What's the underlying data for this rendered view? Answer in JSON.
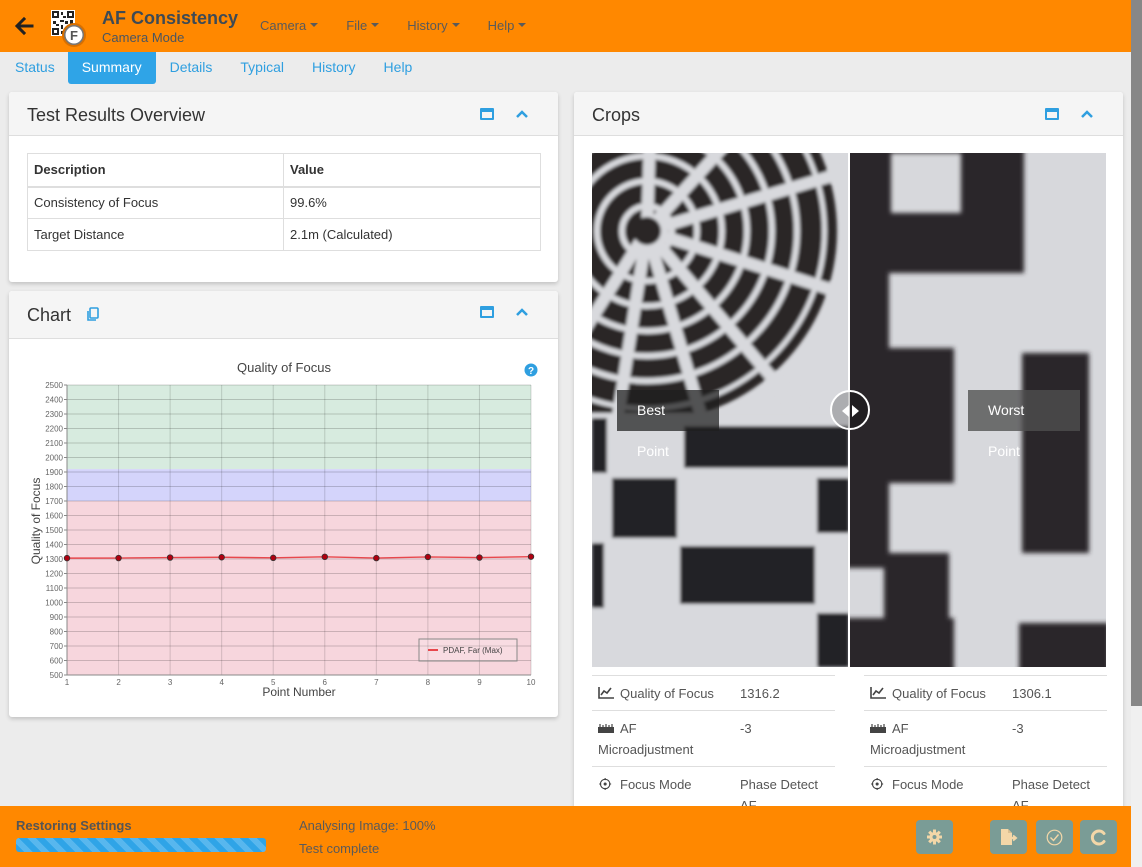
{
  "header": {
    "title": "AF Consistency",
    "subtitle": "Camera Mode",
    "menus": [
      {
        "label": "Camera"
      },
      {
        "label": "File"
      },
      {
        "label": "History"
      },
      {
        "label": "Help"
      }
    ]
  },
  "tabs": [
    {
      "label": "Status",
      "active": false
    },
    {
      "label": "Summary",
      "active": true
    },
    {
      "label": "Details",
      "active": false
    },
    {
      "label": "Typical",
      "active": false
    },
    {
      "label": "History",
      "active": false
    },
    {
      "label": "Help",
      "active": false
    }
  ],
  "overview": {
    "title": "Test Results Overview",
    "columns": [
      "Description",
      "Value"
    ],
    "rows": [
      {
        "description": "Consistency of Focus",
        "value": "99.6%"
      },
      {
        "description": "Target Distance",
        "value": "2.1m (Calculated)"
      }
    ]
  },
  "chart_panel": {
    "title": "Chart"
  },
  "chart_data": {
    "type": "line",
    "title": "Quality of Focus",
    "xlabel": "Point Number",
    "ylabel": "Quality of Focus",
    "x": [
      1,
      2,
      3,
      4,
      5,
      6,
      7,
      8,
      9,
      10
    ],
    "xlim": [
      1,
      10
    ],
    "ylim": [
      500,
      2500
    ],
    "yticks": [
      500,
      600,
      700,
      800,
      900,
      1000,
      1100,
      1200,
      1300,
      1400,
      1500,
      1600,
      1700,
      1800,
      1900,
      2000,
      2100,
      2200,
      2300,
      2400,
      2500
    ],
    "series": [
      {
        "name": "PDAF, Far (Max)",
        "values": [
          1306.1,
          1306.5,
          1310,
          1312,
          1308,
          1315,
          1306.3,
          1314,
          1310,
          1316.2
        ],
        "color": "#e8474c"
      }
    ],
    "bands": [
      {
        "from": 1920,
        "to": 2500,
        "color": "#d7ebdf"
      },
      {
        "from": 1700,
        "to": 1920,
        "color": "#d4d4fb"
      },
      {
        "from": 500,
        "to": 1700,
        "color": "#f7d6dd"
      }
    ],
    "grid": true,
    "legend": "bottom-right"
  },
  "crops": {
    "title": "Crops",
    "best_label": "Best Point",
    "worst_label": "Worst Point",
    "best": {
      "quality_label": "Quality of Focus",
      "quality_value": "1316.2",
      "af_label": "AF Microadjustment",
      "af_value": "-3",
      "mode_label": "Focus Mode",
      "mode_value": "Phase Detect AF"
    },
    "worst": {
      "quality_label": "Quality of Focus",
      "quality_value": "1306.1",
      "af_label": "AF Microadjustment",
      "af_value": "-3",
      "mode_label": "Focus Mode",
      "mode_value": "Phase Detect AF"
    }
  },
  "footer": {
    "status_label": "Restoring Settings",
    "progress": 1.0,
    "line1": "Analysing Image: 100%",
    "line2": "Test complete"
  },
  "colors": {
    "brand": "#ff8800",
    "accent": "#2fa4e7",
    "button": "#7a9c96"
  }
}
